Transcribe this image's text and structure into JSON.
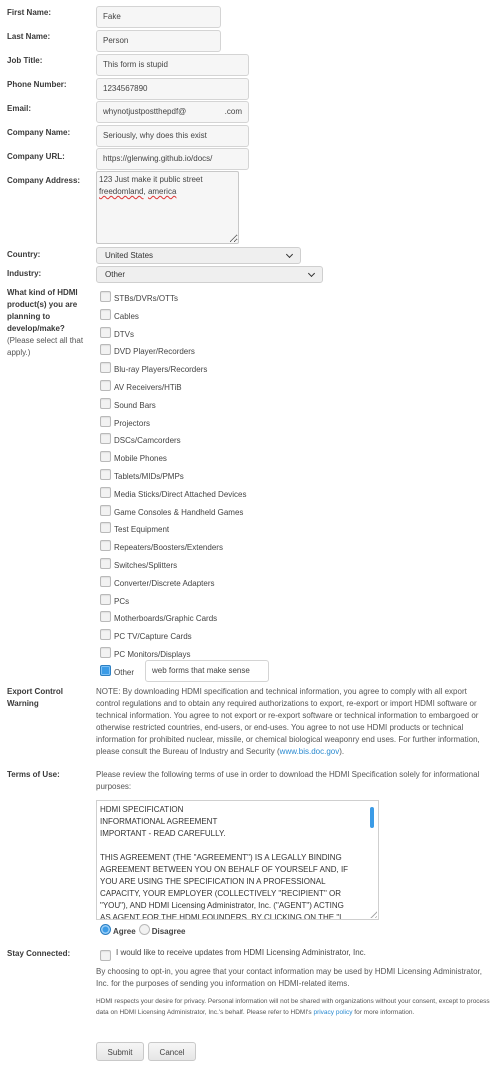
{
  "form": {
    "fields": {
      "first_name": {
        "label": "First Name:",
        "value": "Fake"
      },
      "last_name": {
        "label": "Last Name:",
        "value": "Person"
      },
      "job_title": {
        "label": "Job Title:",
        "value": "This form is stupid"
      },
      "phone": {
        "label": "Phone Number:",
        "value": "1234567890"
      },
      "email": {
        "label": "Email:",
        "value_local": "whynotjustpostthepdf@",
        "value_domain": ".com"
      },
      "company_name": {
        "label": "Company Name:",
        "value": "Seriously, why does this exist"
      },
      "company_url": {
        "label": "Company URL:",
        "value": "https://glenwing.github.io/docs/"
      },
      "company_address": {
        "label": "Company Address:",
        "line1": "123 Just make it public street",
        "line2_a": "freedomland",
        "line2_sep": ", ",
        "line2_b": "america"
      },
      "country": {
        "label": "Country:",
        "value": "United States"
      },
      "industry": {
        "label": "Industry:",
        "value": "Other"
      }
    },
    "products": {
      "label_lines": [
        "What kind of HDMI",
        "product(s) you are",
        "planning to",
        "develop/make?"
      ],
      "sublabel_lines": [
        "(Please select all that",
        "apply.)"
      ],
      "options": [
        {
          "label": "STBs/DVRs/OTTs",
          "checked": false
        },
        {
          "label": "Cables",
          "checked": false
        },
        {
          "label": "DTVs",
          "checked": false
        },
        {
          "label": "DVD Player/Recorders",
          "checked": false
        },
        {
          "label": "Blu-ray Players/Recorders",
          "checked": false
        },
        {
          "label": "AV Receivers/HTiB",
          "checked": false
        },
        {
          "label": "Sound Bars",
          "checked": false
        },
        {
          "label": "Projectors",
          "checked": false
        },
        {
          "label": "DSCs/Camcorders",
          "checked": false
        },
        {
          "label": "Mobile Phones",
          "checked": false
        },
        {
          "label": "Tablets/MIDs/PMPs",
          "checked": false
        },
        {
          "label": "Media Sticks/Direct Attached Devices",
          "checked": false
        },
        {
          "label": "Game Consoles & Handheld Games",
          "checked": false
        },
        {
          "label": "Test Equipment",
          "checked": false
        },
        {
          "label": "Repeaters/Boosters/Extenders",
          "checked": false
        },
        {
          "label": "Switches/Splitters",
          "checked": false
        },
        {
          "label": "Converter/Discrete Adapters",
          "checked": false
        },
        {
          "label": "PCs",
          "checked": false
        },
        {
          "label": "Motherboards/Graphic Cards",
          "checked": false
        },
        {
          "label": "PC TV/Capture Cards",
          "checked": false
        },
        {
          "label": "PC Monitors/Displays",
          "checked": false
        },
        {
          "label": "Other",
          "checked": true
        }
      ],
      "other_value": "web forms that make sense"
    },
    "export_control": {
      "label_lines": [
        "Export Control",
        "Warning"
      ],
      "text": "NOTE: By downloading HDMI specification and technical information, you agree to comply with all export control regulations and to obtain any required authorizations to export, re-export or import HDMI software or technical information. You agree to not export or re-export software or technical information to embargoed or otherwise restricted countries, end-users, or end-uses. You agree to not use HDMI products or technical information for prohibited nuclear, missile, or chemical biological weaponry end uses. For further information, please consult the Bureau of Industry and Security (",
      "link": "www.bis.doc.gov",
      "text_end": ")."
    },
    "terms": {
      "label": "Terms of Use:",
      "intro": "Please review the following terms of use in order to download the HDMI Specification solely for informational purposes:",
      "box_lines": [
        "HDMI SPECIFICATION",
        "INFORMATIONAL AGREEMENT",
        "IMPORTANT - READ CAREFULLY.",
        "",
        "THIS AGREEMENT (THE \"AGREEMENT\") IS A LEGALLY BINDING",
        "AGREEMENT BETWEEN YOU ON BEHALF OF YOURSELF AND, IF",
        "YOU ARE USING THE SPECIFICATION IN A PROFESSIONAL",
        "CAPACITY, YOUR EMPLOYER (COLLECTIVELY \"RECIPIENT\" OR",
        "\"YOU\"), AND HDMI Licensing Administrator, Inc. (\"AGENT\") ACTING",
        "AS AGENT FOR THE HDMI FOUNDERS. BY CLICKING ON THE \"I"
      ],
      "agree_label": "Agree",
      "disagree_label": "Disagree",
      "selected": "Agree"
    },
    "stay_connected": {
      "label": "Stay Connected:",
      "checkbox_label": "I would like to receive updates from HDMI Licensing Administrator, Inc.",
      "checked": false,
      "optin_text": "By choosing to opt-in, you agree that your contact information may be used by HDMI Licensing Administrator, Inc. for the purposes of sending you information on HDMI-related items.",
      "privacy_text": "HDMI respects your desire for privacy. Personal information will not be shared with organizations without your consent, except to process data on HDMI Licensing Administrator, Inc.'s behalf. Please refer to HDMI's ",
      "privacy_link": "privacy policy",
      "privacy_text_end": " for more information."
    },
    "buttons": {
      "submit": "Submit",
      "cancel": "Cancel"
    },
    "colors": {
      "accent": "#3b9be6",
      "link": "#2a8ad0"
    }
  }
}
